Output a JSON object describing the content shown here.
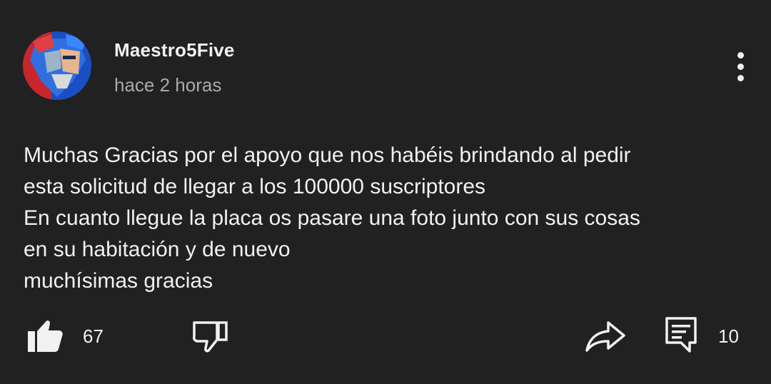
{
  "comment": {
    "author": "Maestro5Five",
    "timestamp": "hace 2 horas",
    "avatar_icon": "avatar-robot-icon",
    "lines": [
      "Muchas Gracias por el apoyo que nos habéis brindando al pedir",
      "esta solicitud de llegar a los 100000 suscriptores",
      "En cuanto llegue la placa os pasare una foto junto con sus cosas",
      "en su habitación y de nuevo",
      "muchísimas gracias"
    ]
  },
  "actions": {
    "like_count": "67",
    "reply_count": "10",
    "icons": {
      "like": "thumbs-up-icon",
      "dislike": "thumbs-down-icon",
      "share": "share-icon",
      "reply": "comment-icon",
      "menu": "more-vertical-icon"
    }
  },
  "colors": {
    "background": "#212121",
    "text_primary": "#f1f1f1",
    "text_secondary": "#aaaaaa"
  }
}
